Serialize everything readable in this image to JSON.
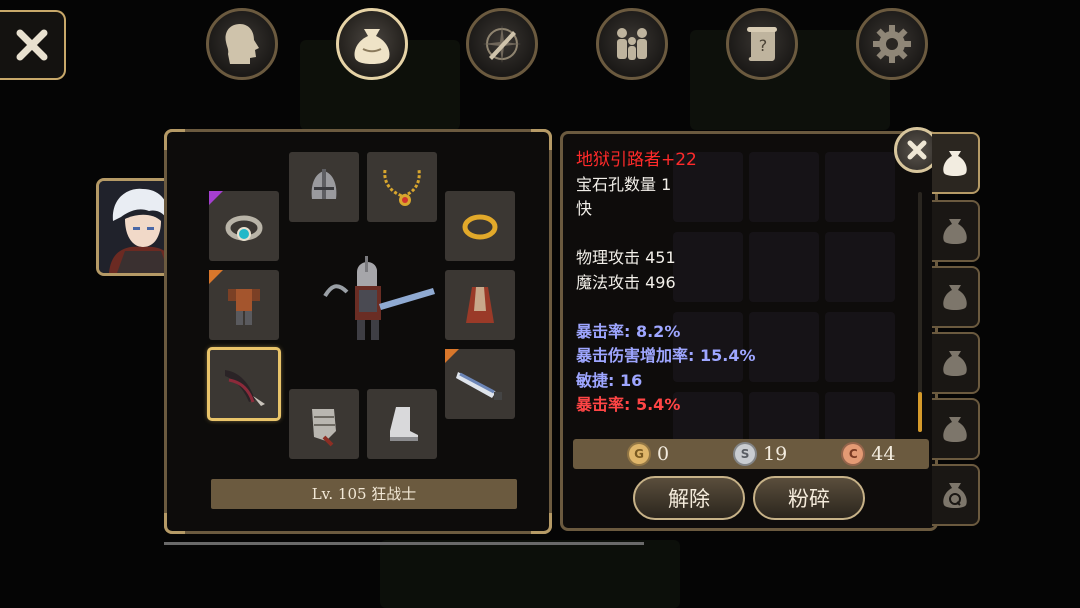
{
  "top_tabs": [
    {
      "name": "character",
      "icon": "head-silhouette-icon"
    },
    {
      "name": "inventory",
      "icon": "bag-icon",
      "active": true
    },
    {
      "name": "skills",
      "icon": "sword-compass-icon"
    },
    {
      "name": "party",
      "icon": "people-icon"
    },
    {
      "name": "quests",
      "icon": "scroll-icon"
    },
    {
      "name": "settings",
      "icon": "gear-icon"
    }
  ],
  "equipment": {
    "level_text": "Lv. 105 狂战士",
    "slots": [
      {
        "slot": "helmet",
        "icon": "helmet-icon",
        "rarity": null
      },
      {
        "slot": "necklace",
        "icon": "necklace-icon",
        "rarity": null
      },
      {
        "slot": "gem-bracelet",
        "icon": "gem-bracelet-icon",
        "rarity": "purple"
      },
      {
        "slot": "ring",
        "icon": "gold-ring-icon",
        "rarity": null
      },
      {
        "slot": "armor",
        "icon": "armor-icon",
        "rarity": "orange"
      },
      {
        "slot": "cape",
        "icon": "cape-icon",
        "rarity": null
      },
      {
        "slot": "weapon-main",
        "icon": "claw-weapon-icon",
        "rarity": null,
        "selected": true
      },
      {
        "slot": "weapon-off",
        "icon": "greatsword-icon",
        "rarity": "orange"
      },
      {
        "slot": "gloves",
        "icon": "gloves-icon",
        "rarity": null
      },
      {
        "slot": "boots",
        "icon": "boots-icon",
        "rarity": null
      }
    ]
  },
  "item": {
    "name": "地狱引路者+22",
    "lines": [
      {
        "text": "宝石孔数量 1",
        "style": "white"
      },
      {
        "text": "快",
        "style": "white"
      },
      {
        "text": "",
        "style": "white"
      },
      {
        "text": "物理攻击 451",
        "style": "white"
      },
      {
        "text": "魔法攻击 496",
        "style": "white"
      },
      {
        "text": "",
        "style": "white"
      },
      {
        "text": "暴击率: 8.2%",
        "style": "blue"
      },
      {
        "text": "暴击伤害增加率: 15.4%",
        "style": "blue"
      },
      {
        "text": "敏捷: 16",
        "style": "blue"
      },
      {
        "text": "暴击率: 5.4%",
        "style": "red"
      }
    ]
  },
  "currency": {
    "gold": {
      "symbol": "G",
      "value": "0"
    },
    "silver": {
      "symbol": "S",
      "value": "19"
    },
    "copper": {
      "symbol": "C",
      "value": "44"
    }
  },
  "actions": {
    "unequip_label": "解除",
    "smash_label": "粉碎"
  },
  "colors": {
    "frame": "#6b5a3f",
    "gold_accent": "#e9c46a",
    "item_name": "#ff2a2a",
    "stat_blue": "#9ea6ff",
    "stat_red": "#ff4545"
  }
}
